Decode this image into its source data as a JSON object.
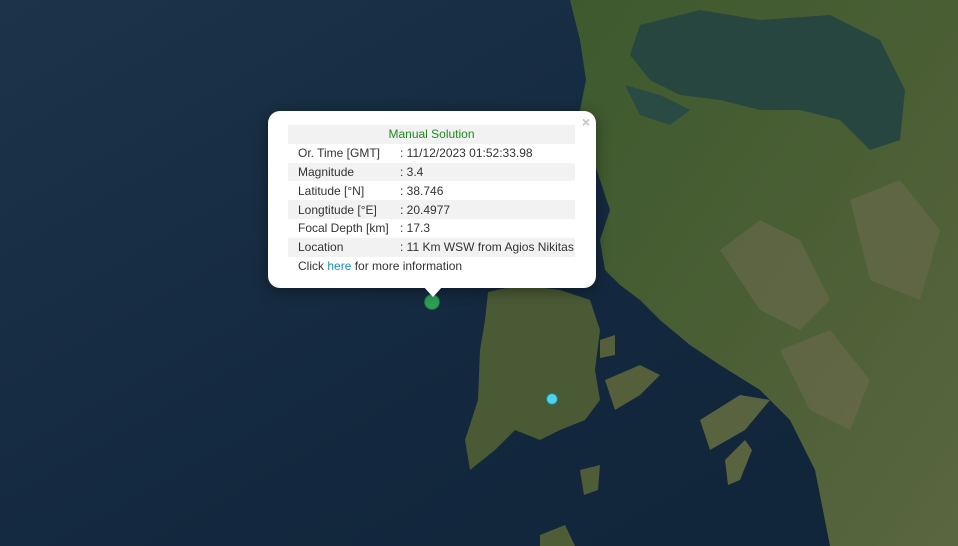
{
  "popup": {
    "title": "Manual Solution",
    "close_symbol": "×",
    "rows": [
      {
        "key": "Or. Time [GMT]",
        "value": ": 11/12/2023 01:52:33.98"
      },
      {
        "key": "Magnitude",
        "value": ": 3.4"
      },
      {
        "key": "Latitude [°N]",
        "value": ": 38.746"
      },
      {
        "key": "Longtitude [°E]",
        "value": ": 20.4977"
      },
      {
        "key": "Focal Depth [km]",
        "value": ": 17.3"
      },
      {
        "key": "Location",
        "value": ": 11 Km WSW from Agios Nikitas"
      }
    ],
    "more_prefix": "Click ",
    "more_link": "here",
    "more_suffix": " for more information"
  },
  "markers": {
    "main_color": "#2e9d55",
    "other_color": "#4fd3e6"
  }
}
